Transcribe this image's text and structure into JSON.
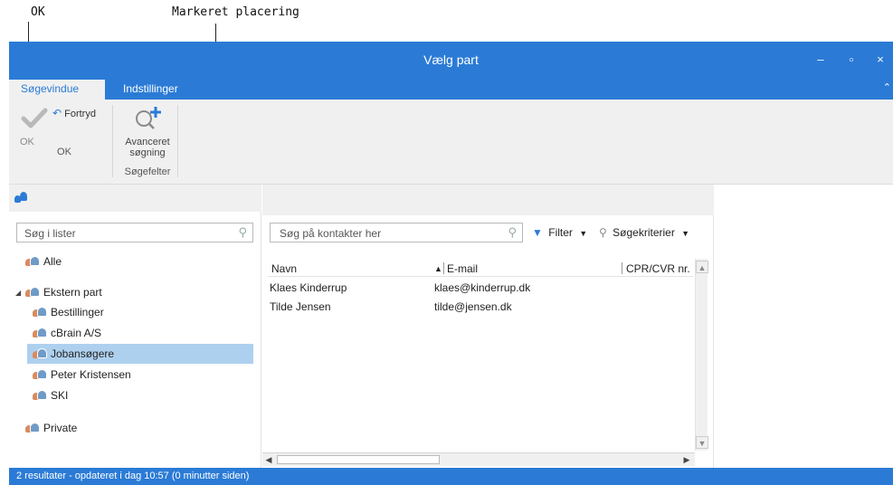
{
  "callouts": {
    "ok": "OK",
    "selected_location": "Markeret placering"
  },
  "window": {
    "title": "Vælg part",
    "minimize_glyph": "‒",
    "maximize_glyph": "▫",
    "close_glyph": "×",
    "collapse_glyph": "⌃"
  },
  "tabs": [
    {
      "label": "Søgevindue",
      "active": true
    },
    {
      "label": "Indstillinger",
      "active": false
    }
  ],
  "ribbon": {
    "ok_label": "OK",
    "undo_label": "Fortryd",
    "advanced_label_1": "Avanceret",
    "advanced_label_2": "søgning",
    "group_ok": "OK",
    "group_search_fields": "Søgefelter"
  },
  "left_pane": {
    "search_placeholder": "Søg i lister",
    "items": [
      {
        "label": "Alle"
      },
      {
        "label": "Ekstern part"
      },
      {
        "label": "Bestillinger"
      },
      {
        "label": "cBrain A/S"
      },
      {
        "label": "Jobansøgere"
      },
      {
        "label": "Peter Kristensen"
      },
      {
        "label": "SKI"
      },
      {
        "label": "Private"
      }
    ],
    "selected_item": "Jobansøgere"
  },
  "middle_pane": {
    "search_placeholder": "Søg på kontakter her",
    "filter_label": "Filter",
    "criteria_label": "Søgekriterier",
    "columns": [
      "Navn",
      "E-mail",
      "CPR/CVR nr."
    ],
    "rows": [
      {
        "name": "Klaes Kinderrup",
        "email": "klaes@kinderrup.dk",
        "cpr": ""
      },
      {
        "name": "Tilde Jensen",
        "email": "tilde@jensen.dk",
        "cpr": ""
      }
    ]
  },
  "status": {
    "text": "2 resultater - opdateret i dag 10:57 (0 minutter siden)"
  },
  "colors": {
    "accent": "#2b7bd6",
    "selection": "#aed0ef",
    "filter_icon": "#2b7bd6"
  }
}
